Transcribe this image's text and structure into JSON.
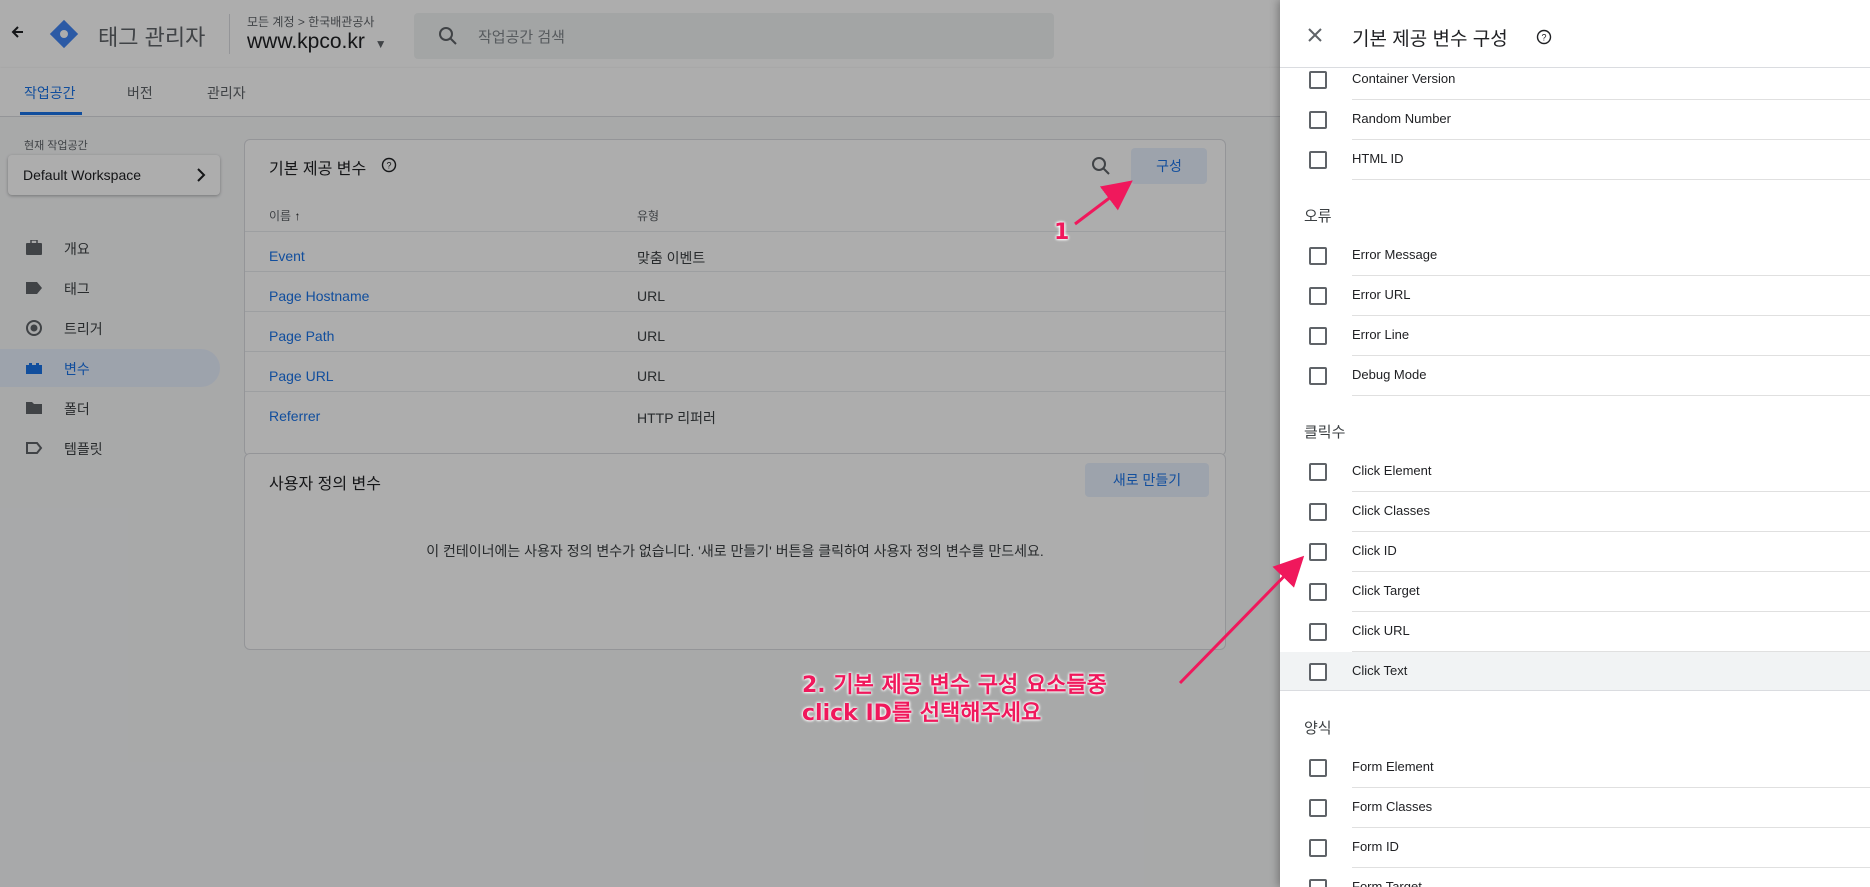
{
  "header": {
    "back_icon": "arrow-left-icon",
    "product_name": "태그 관리자",
    "breadcrumb_account": "모든 계정 > 한국배관공사",
    "container_name": "www.kpco.kr",
    "search_placeholder": "작업공간 검색"
  },
  "tabs": [
    {
      "label": "작업공간",
      "active": true
    },
    {
      "label": "버전",
      "active": false
    },
    {
      "label": "관리자",
      "active": false
    }
  ],
  "workspace": {
    "caption": "현재 작업공간",
    "name": "Default Workspace"
  },
  "sidebar": {
    "items": [
      {
        "label": "개요",
        "icon": "briefcase-icon",
        "active": false
      },
      {
        "label": "태그",
        "icon": "tag-icon",
        "active": false
      },
      {
        "label": "트리거",
        "icon": "trigger-icon",
        "active": false
      },
      {
        "label": "변수",
        "icon": "variables-icon",
        "active": true
      },
      {
        "label": "폴더",
        "icon": "folder-icon",
        "active": false
      },
      {
        "label": "템플릿",
        "icon": "template-icon",
        "active": false
      }
    ]
  },
  "builtin_card": {
    "title": "기본 제공 변수",
    "configure_label": "구성",
    "col_name": "이름",
    "col_type": "유형",
    "rows": [
      {
        "name": "Event",
        "type": "맞춤 이벤트"
      },
      {
        "name": "Page Hostname",
        "type": "URL"
      },
      {
        "name": "Page Path",
        "type": "URL"
      },
      {
        "name": "Page URL",
        "type": "URL"
      },
      {
        "name": "Referrer",
        "type": "HTTP 리퍼러"
      }
    ]
  },
  "user_card": {
    "title": "사용자 정의 변수",
    "new_label": "새로 만들기",
    "empty_text": "이 컨테이너에는 사용자 정의 변수가 없습니다. '새로 만들기' 버튼을 클릭하여 사용자 정의 변수를 만드세요."
  },
  "panel": {
    "title": "기본 제공 변수 구성",
    "top_items": [
      "Container Version",
      "Random Number",
      "HTML ID"
    ],
    "error_section": "오류",
    "error_items": [
      "Error Message",
      "Error URL",
      "Error Line",
      "Debug Mode"
    ],
    "click_section": "클릭수",
    "click_items": [
      "Click Element",
      "Click Classes",
      "Click ID",
      "Click Target",
      "Click URL",
      "Click Text"
    ],
    "form_section": "양식",
    "form_items": [
      "Form Element",
      "Form Classes",
      "Form ID",
      "Form Target"
    ]
  },
  "annotations": {
    "step1": "1",
    "step2_line1": "2. 기본 제공 변수 구성 요소들중",
    "step2_line2": "click ID를 선택해주세요",
    "color": "#f0185c"
  }
}
